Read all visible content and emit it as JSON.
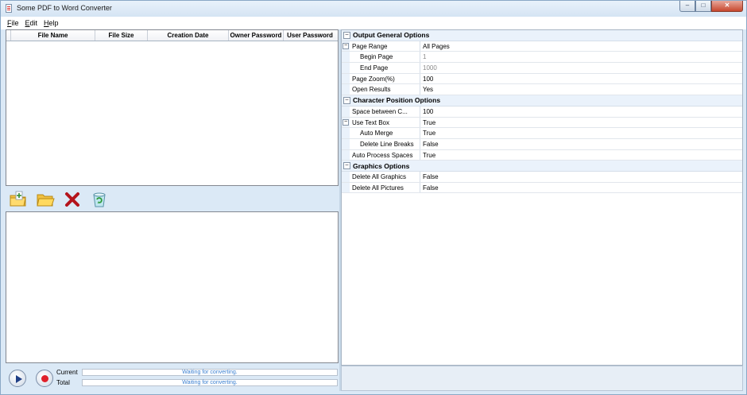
{
  "window": {
    "title": "Some PDF to Word Converter"
  },
  "menu": [
    {
      "label": "File",
      "accel": "F",
      "rest": "ile"
    },
    {
      "label": "Edit",
      "accel": "E",
      "rest": "dit"
    },
    {
      "label": "Help",
      "accel": "H",
      "rest": "elp"
    }
  ],
  "file_table": {
    "columns": [
      "",
      "File Name",
      "File Size",
      "Creation Date",
      "Owner Password",
      "User Password"
    ],
    "rows": []
  },
  "toolbar": {
    "buttons": [
      {
        "name": "add-files-button",
        "icon": "folder-add-icon"
      },
      {
        "name": "open-folder-button",
        "icon": "folder-open-icon"
      },
      {
        "name": "remove-button",
        "icon": "red-x-icon"
      },
      {
        "name": "clear-button",
        "icon": "recycle-bin-icon"
      }
    ]
  },
  "progress": {
    "current_label": "Current",
    "total_label": "Total",
    "current_text": "Waiting for converting.",
    "total_text": "Waiting for converting."
  },
  "properties": [
    {
      "category": "Output General Options",
      "items": [
        {
          "name": "Page Range",
          "value": "All Pages",
          "expandable": true
        },
        {
          "name": "Begin Page",
          "value": "1",
          "sub": true,
          "dim": true
        },
        {
          "name": "End Page",
          "value": "1000",
          "sub": true,
          "dim": true
        },
        {
          "name": "Page Zoom(%)",
          "value": "100"
        },
        {
          "name": "Open Results",
          "value": "Yes"
        }
      ]
    },
    {
      "category": "Character Position Options",
      "items": [
        {
          "name": "Space between C...",
          "value": "100"
        },
        {
          "name": "Use Text Box",
          "value": "True",
          "expandable": true
        },
        {
          "name": "Auto Merge",
          "value": "True",
          "sub": true
        },
        {
          "name": "Delete Line Breaks",
          "value": "False",
          "sub": true
        },
        {
          "name": "Auto Process Spaces",
          "value": "True"
        }
      ]
    },
    {
      "category": "Graphics Options",
      "items": [
        {
          "name": "Delete All Graphics",
          "value": "False"
        },
        {
          "name": "Delete All Pictures",
          "value": "False"
        }
      ]
    }
  ],
  "colors": {
    "accent": "#3a7fd0",
    "frame": "#dbe9f6",
    "stop": "#e0202a"
  }
}
